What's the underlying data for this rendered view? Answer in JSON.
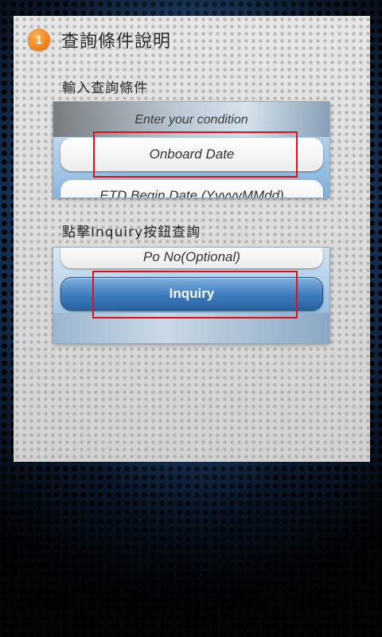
{
  "step": {
    "number": "1",
    "title": "查詢條件說明"
  },
  "instructions": [
    {
      "text": "輸入查詢條件"
    },
    {
      "text": "點擊Inquiry按鈕查詢"
    }
  ],
  "screenshot_1": {
    "hint": "Enter your condition",
    "field_onboard": "Onboard Date",
    "field_etd": "ETD Begin Date (YyyyyMMdd)"
  },
  "screenshot_2": {
    "field_po": "Po No(Optional)",
    "inquiry_button": "Inquiry"
  },
  "colors": {
    "badge": "#f07a10",
    "highlight": "#e0101a",
    "button": "#3d7cbd"
  }
}
